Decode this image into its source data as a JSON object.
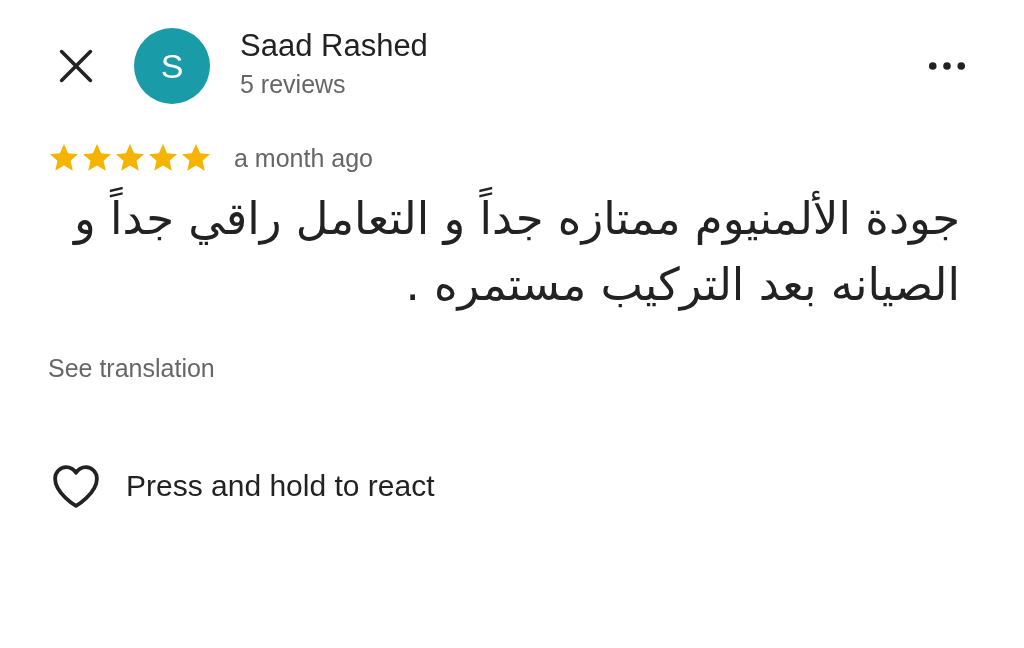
{
  "reviewer": {
    "initial": "S",
    "name": "Saad Rashed",
    "review_count": "5 reviews"
  },
  "review": {
    "stars": 5,
    "time": "a month ago",
    "text": "جودة الألمنيوم ممتازه جداً و التعامل راقي جداً و الصيانه بعد التركيب مستمره ."
  },
  "see_translation": "See translation",
  "react_label": "Press and hold to react"
}
